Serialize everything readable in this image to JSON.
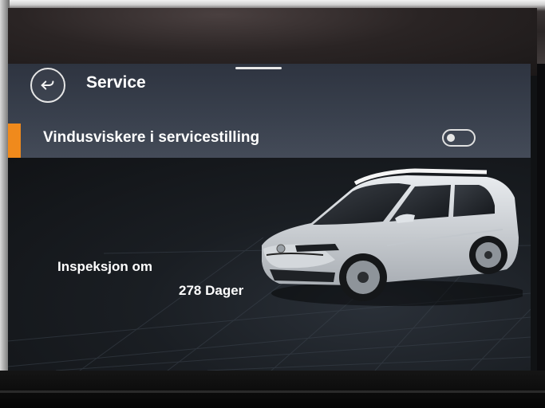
{
  "header": {
    "title": "Service",
    "back_icon": "back-arrow-icon"
  },
  "settings": {
    "wiper_service_label": "Vindusviskere i servicestilling",
    "wiper_service_enabled": false
  },
  "inspection": {
    "label": "Inspeksjon om",
    "value": "278 Dager"
  },
  "colors": {
    "accent": "#f08a1c",
    "header_bar": "#3a414e",
    "text": "#ffffff"
  }
}
